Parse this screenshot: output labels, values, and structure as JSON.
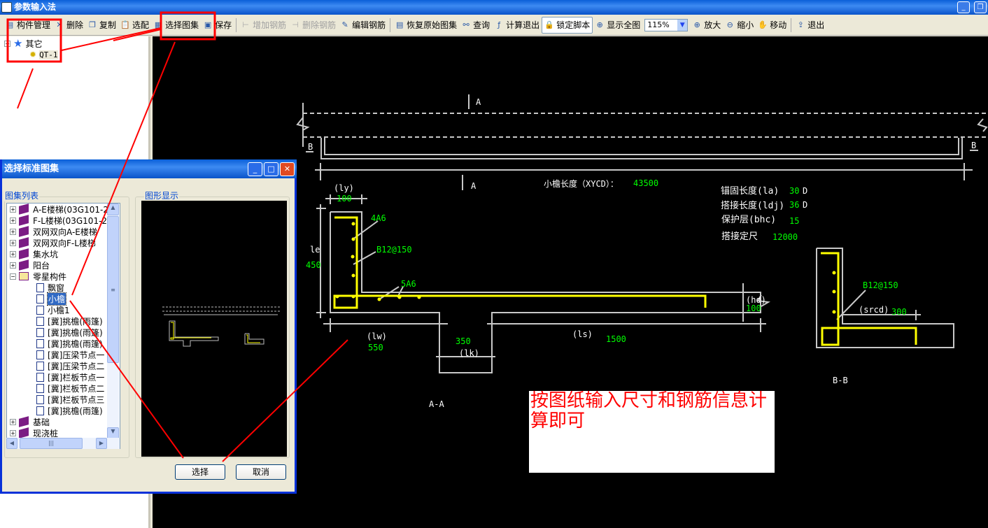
{
  "window": {
    "title": "参数输入法"
  },
  "toolbar": {
    "items": [
      {
        "label": "构件管理",
        "icon": "component-manage-icon",
        "enabled": true
      },
      {
        "label": "删除",
        "icon": "delete-x-icon",
        "enabled": true
      },
      {
        "label": "复制",
        "icon": "copy-icon",
        "enabled": true
      },
      {
        "label": "选配",
        "icon": "clipboard-icon",
        "enabled": true
      },
      {
        "label": "选择图集",
        "icon": "select-atlas-icon",
        "enabled": true
      },
      {
        "label": "保存",
        "icon": "save-disk-icon",
        "enabled": true
      },
      {
        "label": "增加钢筋",
        "icon": "add-rebar-icon",
        "enabled": false
      },
      {
        "label": "删除钢筋",
        "icon": "remove-rebar-icon",
        "enabled": false
      },
      {
        "label": "编辑钢筋",
        "icon": "edit-rebar-icon",
        "enabled": true
      },
      {
        "label": "恢复原始图集",
        "icon": "restore-icon",
        "enabled": true
      },
      {
        "label": "查询",
        "icon": "binoculars-icon",
        "enabled": true
      },
      {
        "label": "计算退出",
        "icon": "function-icon",
        "enabled": true
      },
      {
        "label": "锁定脚本",
        "icon": "lock-icon",
        "enabled": true,
        "pressed": true
      },
      {
        "label": "显示全图",
        "icon": "fit-view-icon",
        "enabled": true
      },
      {
        "label": "放大",
        "icon": "zoom-in-icon",
        "enabled": true
      },
      {
        "label": "缩小",
        "icon": "zoom-out-icon",
        "enabled": true
      },
      {
        "label": "移动",
        "icon": "pan-hand-icon",
        "enabled": true
      },
      {
        "label": "退出",
        "icon": "exit-icon",
        "enabled": true
      }
    ],
    "zoom_value": "115%"
  },
  "component_tree": {
    "root": "其它",
    "child": "QT-1"
  },
  "dialog": {
    "title": "选择标准图集",
    "list_label": "图集列表",
    "preview_label": "图形显示",
    "select_button": "选择",
    "cancel_button": "取消",
    "tree": [
      {
        "label": "A-E楼梯(03G101-2)",
        "type": "book"
      },
      {
        "label": "F-L楼梯(03G101-2)",
        "type": "book"
      },
      {
        "label": "双网双向A-E楼梯",
        "type": "book"
      },
      {
        "label": "双网双向F-L楼梯",
        "type": "book"
      },
      {
        "label": "集水坑",
        "type": "book"
      },
      {
        "label": "阳台",
        "type": "book"
      },
      {
        "label": "零星构件",
        "type": "open-book",
        "expanded": true
      },
      {
        "label": "飘窗",
        "type": "doc"
      },
      {
        "label": "小檐",
        "type": "doc",
        "selected": true
      },
      {
        "label": "小檐1",
        "type": "doc"
      },
      {
        "label": "[冀]挑檐(雨篷)",
        "type": "doc"
      },
      {
        "label": "[冀]挑檐(雨篷)",
        "type": "doc"
      },
      {
        "label": "[冀]挑檐(雨篷)",
        "type": "doc"
      },
      {
        "label": "[冀]压梁节点一",
        "type": "doc"
      },
      {
        "label": "[冀]压梁节点二",
        "type": "doc"
      },
      {
        "label": "[冀]栏板节点一",
        "type": "doc"
      },
      {
        "label": "[冀]栏板节点二",
        "type": "doc"
      },
      {
        "label": "[冀]栏板节点三",
        "type": "doc"
      },
      {
        "label": "[冀]挑檐(雨篷)",
        "type": "doc"
      },
      {
        "label": "基础",
        "type": "book"
      },
      {
        "label": "现浇桩",
        "type": "book"
      }
    ]
  },
  "drawing": {
    "section_mark_a": "A",
    "section_mark_b": "B",
    "length_label": "小檐长度（XYCD）：",
    "length_value": "43500",
    "ly_label": "(ly)",
    "ly_value": "100",
    "le_label": "le",
    "le_value": "450",
    "rebar_top": "4A6",
    "rebar_main": "B12@150",
    "rebar_bottom": "5A6",
    "hd_label": "(hd)",
    "hd_value": "100",
    "lw_label": "(lw)",
    "lw_value": "550",
    "lk_label": "(lk)",
    "lk_value": "350",
    "ls_label": "(ls)",
    "ls_value": "1500",
    "section_aa": "A-A",
    "section_bb": "B-B",
    "srcd_label": "(srcd)",
    "srcd_value": "300",
    "params": [
      {
        "label": "锚固长度(la)",
        "value": "30",
        "unit": "D"
      },
      {
        "label": "搭接长度(ldj)",
        "value": "36",
        "unit": "D"
      },
      {
        "label": "保护层(bhc)",
        "value": "15",
        "unit": ""
      },
      {
        "label": "搭接定尺",
        "value": "12000",
        "unit": ""
      }
    ]
  },
  "annotation": {
    "note": "按图纸输入尺寸和钢筋信息计算即可",
    "color": "#ff0000"
  },
  "colors": {
    "rebar": "#ffff00",
    "dimension_value": "#00ff00",
    "canvas": "#000000",
    "highlight": "#ff0000"
  }
}
